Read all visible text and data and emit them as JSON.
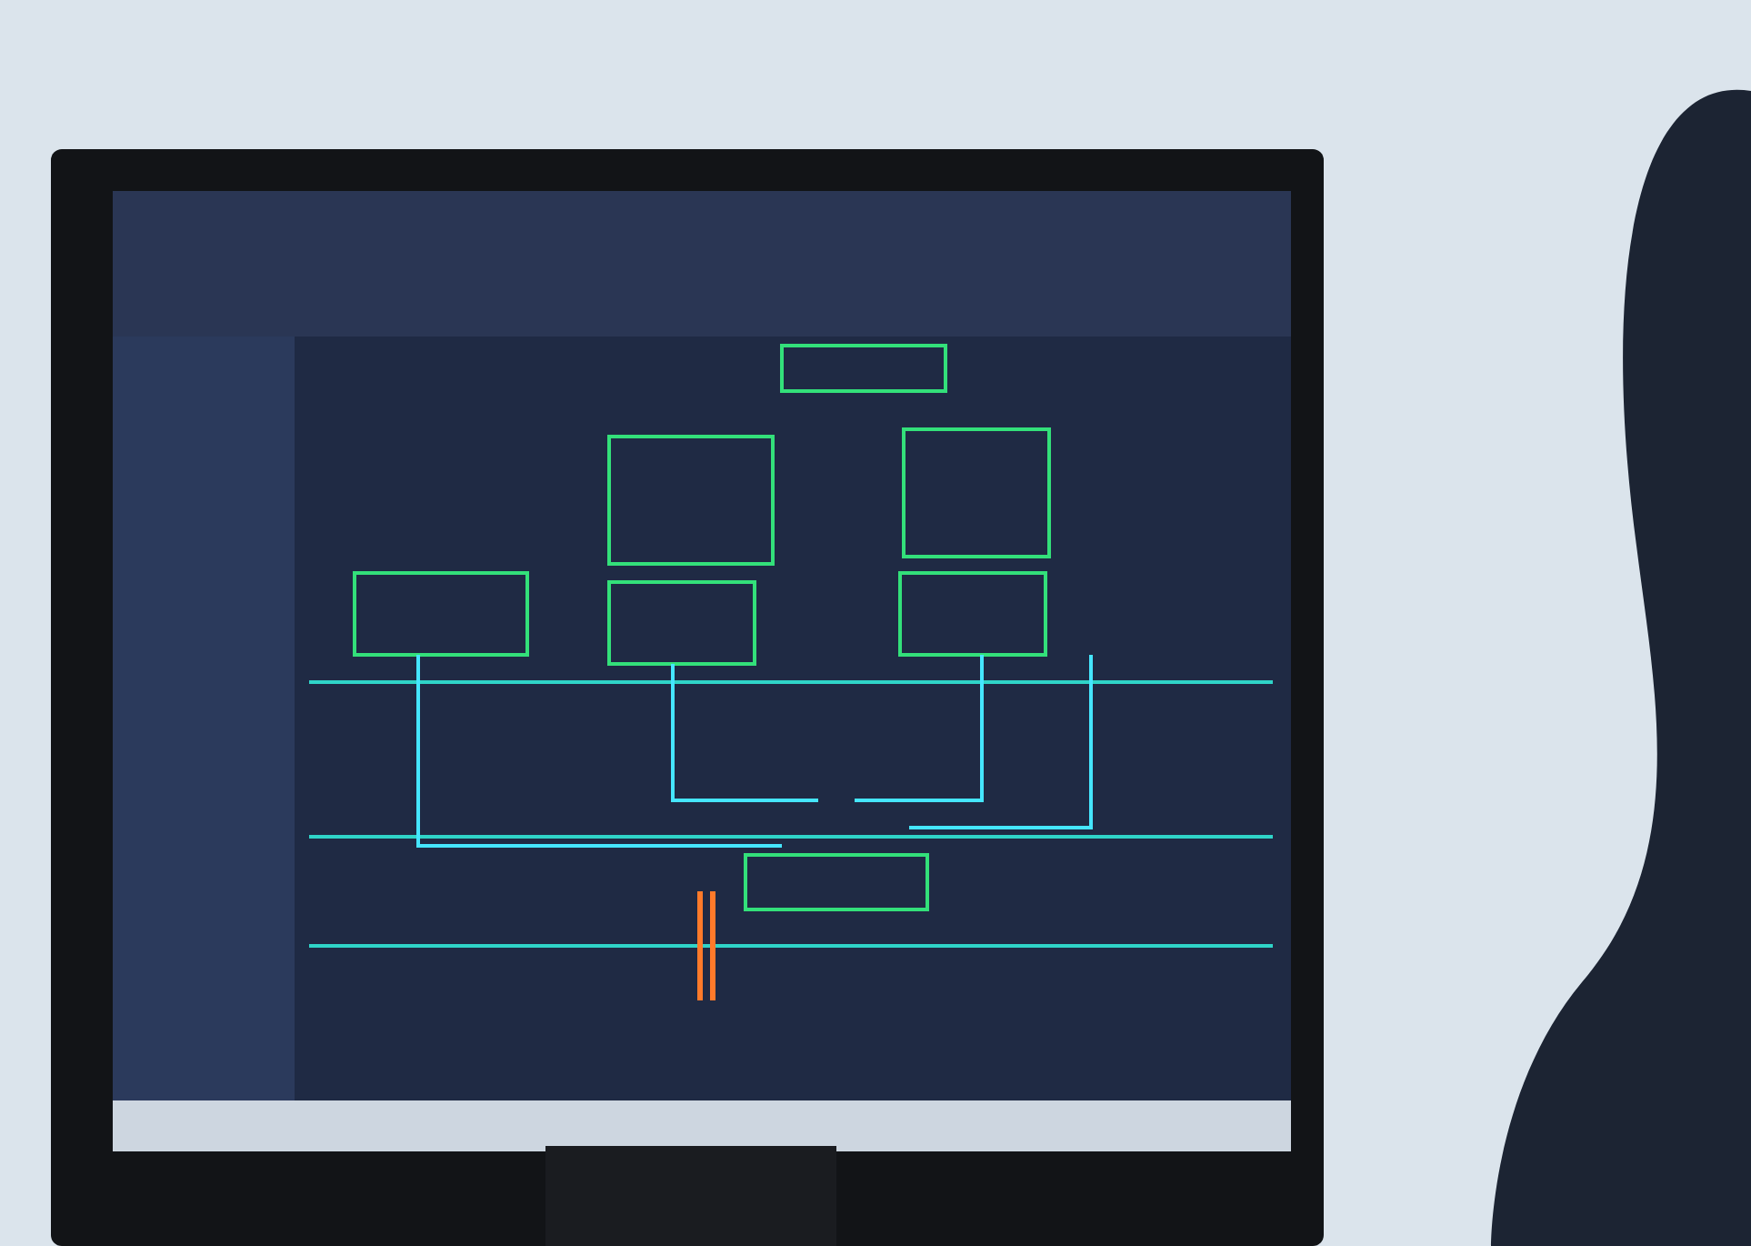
{
  "photo": {
    "kind": "monitor-scene"
  }
}
